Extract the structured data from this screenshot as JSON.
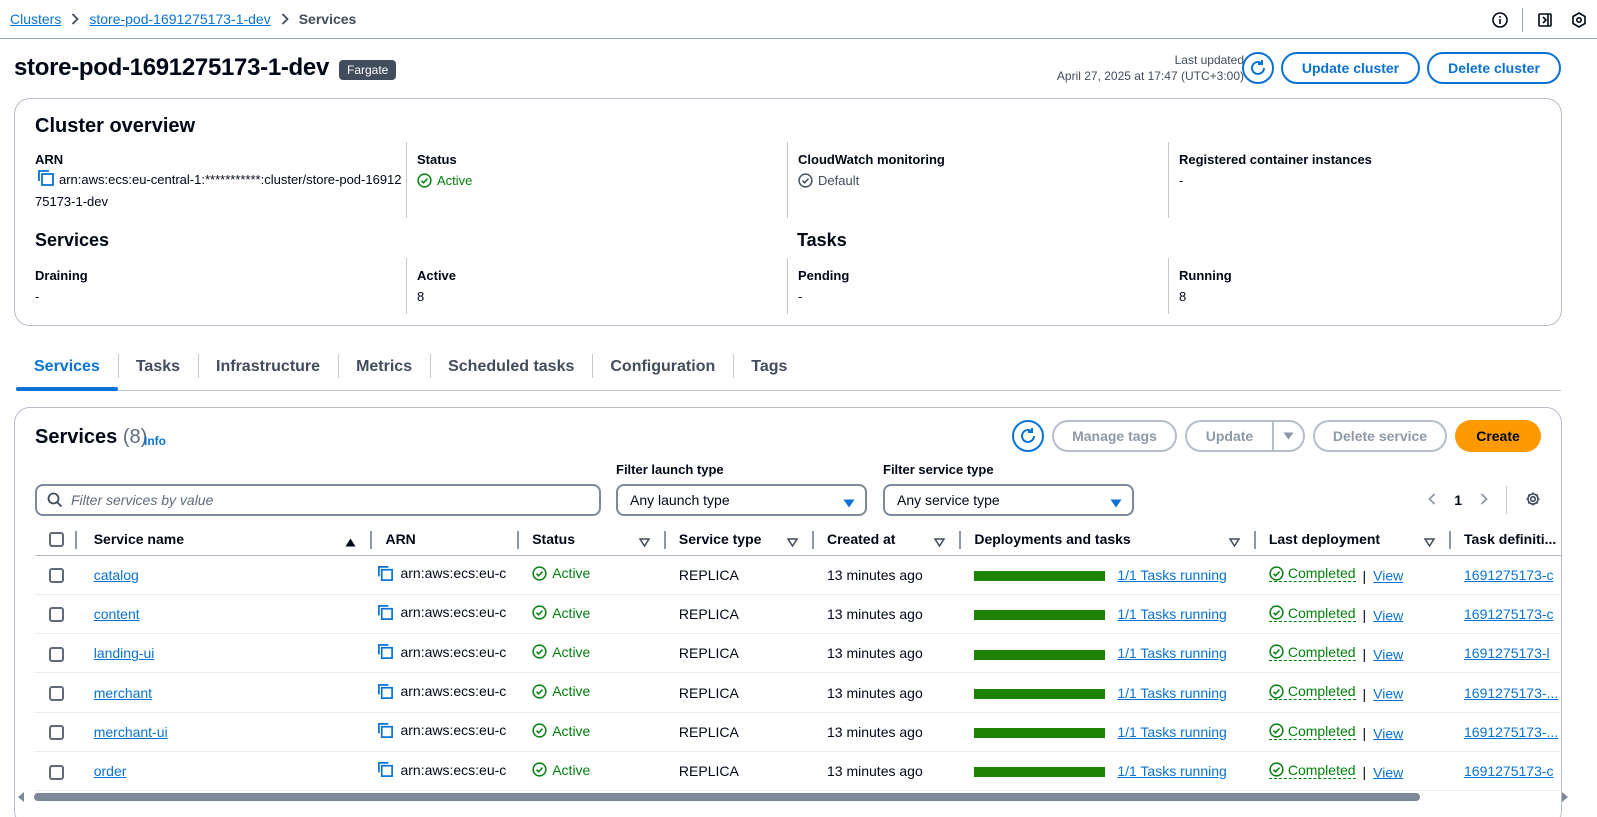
{
  "breadcrumb": {
    "items": [
      "Clusters",
      "store-pod-1691275173-1-dev"
    ],
    "current": "Services"
  },
  "header": {
    "title": "store-pod-1691275173-1-dev",
    "badge": "Fargate",
    "last_updated_label": "Last updated",
    "last_updated_value": "April 27, 2025 at 17:47 (UTC+3:00)",
    "update_cluster": "Update cluster",
    "delete_cluster": "Delete cluster"
  },
  "overview": {
    "title": "Cluster overview",
    "arn_label": "ARN",
    "arn_value": "arn:aws:ecs:eu-central-1:***********:cluster/store-pod-1691275173-1-dev",
    "status_label": "Status",
    "status_value": "Active",
    "cloudwatch_label": "CloudWatch monitoring",
    "cloudwatch_value": "Default",
    "registered_label": "Registered container instances",
    "registered_value": "-",
    "services_title": "Services",
    "draining_label": "Draining",
    "draining_value": "-",
    "active_label": "Active",
    "active_value": "8",
    "tasks_title": "Tasks",
    "pending_label": "Pending",
    "pending_value": "-",
    "running_label": "Running",
    "running_value": "8"
  },
  "tabs": [
    "Services",
    "Tasks",
    "Infrastructure",
    "Metrics",
    "Scheduled tasks",
    "Configuration",
    "Tags"
  ],
  "services_panel": {
    "title": "Services",
    "count": "(8)",
    "info": "Info",
    "manage_tags": "Manage tags",
    "update": "Update",
    "delete_service": "Delete service",
    "create": "Create",
    "filter_launch_label": "Filter launch type",
    "filter_launch_value": "Any launch type",
    "filter_service_label": "Filter service type",
    "filter_service_value": "Any service type",
    "search_placeholder": "Filter services by value",
    "page": "1"
  },
  "table": {
    "columns": [
      "Service name",
      "ARN",
      "Status",
      "Service type",
      "Created at",
      "Deployments and tasks",
      "Last deployment",
      "Task definiti..."
    ],
    "rows": [
      {
        "name": "catalog",
        "arn": "arn:aws:ecs:eu-c",
        "status": "Active",
        "type": "REPLICA",
        "created": "13 minutes ago",
        "tasks": "1/1 Tasks running",
        "deploy": "Completed",
        "view": "View",
        "taskdef": "1691275173-c"
      },
      {
        "name": "content",
        "arn": "arn:aws:ecs:eu-c",
        "status": "Active",
        "type": "REPLICA",
        "created": "13 minutes ago",
        "tasks": "1/1 Tasks running",
        "deploy": "Completed",
        "view": "View",
        "taskdef": "1691275173-c"
      },
      {
        "name": "landing-ui",
        "arn": "arn:aws:ecs:eu-c",
        "status": "Active",
        "type": "REPLICA",
        "created": "13 minutes ago",
        "tasks": "1/1 Tasks running",
        "deploy": "Completed",
        "view": "View",
        "taskdef": "1691275173-l"
      },
      {
        "name": "merchant",
        "arn": "arn:aws:ecs:eu-c",
        "status": "Active",
        "type": "REPLICA",
        "created": "13 minutes ago",
        "tasks": "1/1 Tasks running",
        "deploy": "Completed",
        "view": "View",
        "taskdef": "1691275173-..."
      },
      {
        "name": "merchant-ui",
        "arn": "arn:aws:ecs:eu-c",
        "status": "Active",
        "type": "REPLICA",
        "created": "13 minutes ago",
        "tasks": "1/1 Tasks running",
        "deploy": "Completed",
        "view": "View",
        "taskdef": "1691275173-..."
      },
      {
        "name": "order",
        "arn": "arn:aws:ecs:eu-c",
        "status": "Active",
        "type": "REPLICA",
        "created": "13 minutes ago",
        "tasks": "1/1 Tasks running",
        "deploy": "Completed",
        "view": "View",
        "taskdef": "1691275173-c"
      }
    ]
  },
  "colors": {
    "link": "#0972d3",
    "success": "#037f0c",
    "primary": "#ff9900",
    "bar": "#1d8102"
  }
}
